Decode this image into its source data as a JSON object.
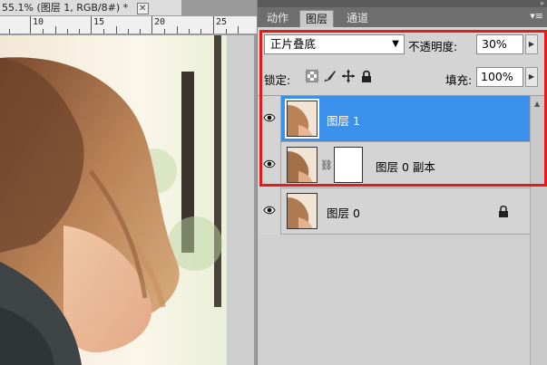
{
  "document": {
    "tab_title": "55.1% (图层 1, RGB/8#) *",
    "close_glyph": "✕",
    "ruler_labels": [
      "10",
      "15",
      "20",
      "25"
    ]
  },
  "panel": {
    "tabs": [
      "动作",
      "图层",
      "通道"
    ],
    "active_tab": "图层",
    "menu_glyph": "▾≡",
    "collapse_glyph": "»",
    "blend_mode": "正片叠底",
    "opacity_label": "不透明度:",
    "opacity_value": "30%",
    "lock_label": "锁定:",
    "fill_label": "填充:",
    "fill_value": "100%"
  },
  "layers": [
    {
      "name": "图层 1",
      "selected": true,
      "has_mask": false,
      "locked": false
    },
    {
      "name": "图层 0 副本",
      "selected": false,
      "has_mask": true,
      "locked": false
    },
    {
      "name": "图层 0",
      "selected": false,
      "has_mask": false,
      "locked": true
    }
  ],
  "icons": {
    "eye": "eye-icon",
    "lock": "lock-icon",
    "chain": "chain-link-icon",
    "lock_transparent": "lock-transparent-pixels-icon",
    "lock_image": "lock-image-pixels-icon",
    "lock_position": "lock-position-icon",
    "lock_all": "lock-all-icon"
  },
  "colors": {
    "selection": "#3a90ea",
    "highlight_box": "#e21b1b"
  }
}
